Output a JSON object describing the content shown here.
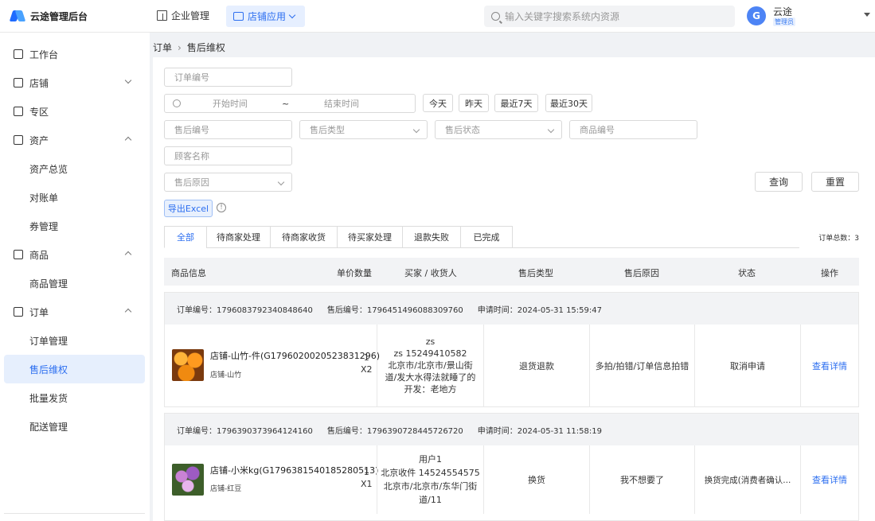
{
  "app": {
    "title": "云途管理后台"
  },
  "topnav": {
    "enterprise": "企业管理",
    "shop_app": "店铺应用",
    "search_placeholder": "输入关键字搜索系统内资源"
  },
  "user": {
    "avatar_letter": "G",
    "name": "云途",
    "role": "管理员"
  },
  "sidebar": {
    "items": [
      {
        "label": "工作台"
      },
      {
        "label": "店铺"
      },
      {
        "label": "专区"
      },
      {
        "label": "资产"
      },
      {
        "label": "资产总览"
      },
      {
        "label": "对账单"
      },
      {
        "label": "券管理"
      },
      {
        "label": "商品"
      },
      {
        "label": "商品管理"
      },
      {
        "label": "订单"
      },
      {
        "label": "订单管理"
      },
      {
        "label": "售后维权"
      },
      {
        "label": "批量发货"
      },
      {
        "label": "配送管理"
      }
    ]
  },
  "breadcrumb": {
    "parent": "订单",
    "sep": "›",
    "current": "售后维权"
  },
  "filters": {
    "order_no": "订单编号",
    "start_time": "开始时间",
    "range_sep": "~",
    "end_time": "结束时间",
    "quick": [
      "今天",
      "昨天",
      "最近7天",
      "最近30天"
    ],
    "after_sale_no": "售后编号",
    "after_sale_type": "售后类型",
    "after_sale_status": "售后状态",
    "goods_no": "商品编号",
    "customer_name": "顾客名称",
    "after_sale_reason": "售后原因",
    "query": "查询",
    "reset": "重置",
    "export": "导出Excel",
    "info": "!"
  },
  "tabs": [
    "全部",
    "待商家处理",
    "待商家收货",
    "待买家处理",
    "退款失败",
    "已完成"
  ],
  "total": "订单总数：3",
  "table": {
    "headers": [
      "商品信息",
      "单价数量",
      "买家 / 收货人",
      "售后类型",
      "售后原因",
      "状态",
      "操作"
    ]
  },
  "orders": [
    {
      "order_no": "订单编号：1796083792340848640",
      "after_no": "售后编号：1796451496088309760",
      "apply_time": "申请时间：2024-05-31 15:59:47",
      "goods_name": "店铺-山竹-件(G1796020020523831296)",
      "shop": "店铺-山竹",
      "price": "1",
      "qty": "X2",
      "buyer": [
        "zs",
        "zs 15249410582",
        "北京市/北京市/景山街",
        "道/发大水得法就睡了的",
        "开发：老地方"
      ],
      "type": "退货退款",
      "reason": "多拍/拍错/订单信息拍错",
      "status": "取消申请",
      "action": "查看详情"
    },
    {
      "order_no": "订单编号：1796390373964124160",
      "after_no": "售后编号：1796390728445726720",
      "apply_time": "申请时间：2024-05-31 11:58:19",
      "goods_name": "店铺-小米kg(G1796381540185280513)",
      "shop": "店铺-红豆",
      "price": "1",
      "qty": "X1",
      "buyer": [
        "用户1",
        "北京收件 14524554575",
        "北京市/北京市/东华门街",
        "道/11"
      ],
      "type": "换货",
      "reason": "我不想要了",
      "status": "换货完成(消费者确认...",
      "action": "查看详情"
    }
  ]
}
